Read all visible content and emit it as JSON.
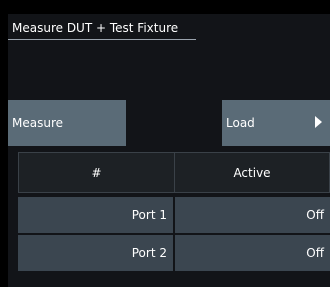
{
  "dialog": {
    "title": "Measure DUT + Test Fixture"
  },
  "buttons": {
    "measure_label": "Measure",
    "load_label": "Load"
  },
  "table": {
    "headers": [
      "#",
      "Active"
    ],
    "rows": [
      {
        "port": "Port 1",
        "active": "Off"
      },
      {
        "port": "Port 2",
        "active": "Off"
      }
    ]
  },
  "colors": {
    "background": "#000000",
    "panel": "#121418",
    "button": "#5a6b77",
    "header_cell": "#1d2125",
    "row_cell": "#3b4650",
    "text": "#ffffff"
  }
}
